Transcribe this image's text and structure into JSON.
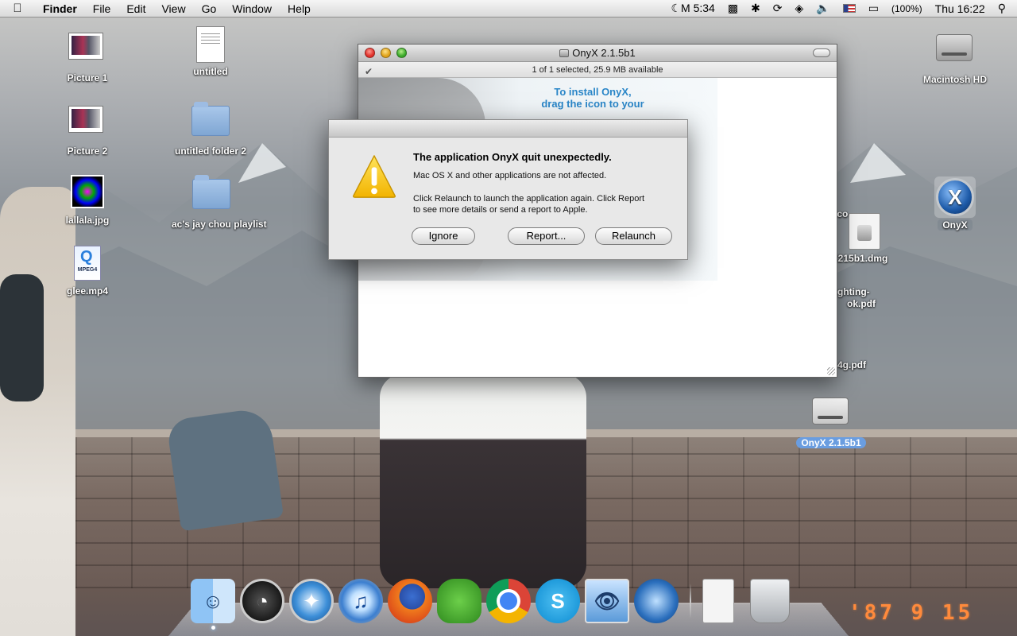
{
  "menubar": {
    "app_name": "Finder",
    "menus": [
      "File",
      "Edit",
      "View",
      "Go",
      "Window",
      "Help"
    ],
    "status": {
      "moon_time": "☾M 5:34",
      "battery_percent": "(100%)",
      "clock": "Thu 16:22"
    }
  },
  "desktop_icons": {
    "picture1": "Picture 1",
    "untitled": "untitled",
    "macintosh_hd": "Macintosh HD",
    "picture2": "Picture 2",
    "untitled_folder2": "untitled folder 2",
    "lallala": "lallala.jpg",
    "playlist": "ac's jay chou playlist",
    "onyx_app": "OnyX",
    "glee": "glee.mp4",
    "dmg_partial": "yX215b1.dmg",
    "pdf1_line1": "ghting-",
    "pdf1_line2": "ok.pdf",
    "pdf2": "4g.pdf",
    "ico_partial": "ico",
    "onyx_volume": "OnyX 2.1.5b1"
  },
  "finder_window": {
    "title": "OnyX 2.1.5b1",
    "status": "1 of 1 selected, 25.9 MB available",
    "install_line1": "To install OnyX,",
    "install_line2": "drag the icon to your"
  },
  "alert": {
    "heading": "The application OnyX quit unexpectedly.",
    "subtext": "Mac OS X and other applications are not affected.",
    "message": "Click Relaunch to launch the application again. Click Report to see more details or send a report to Apple.",
    "buttons": {
      "ignore": "Ignore",
      "report": "Report...",
      "relaunch": "Relaunch"
    }
  },
  "dock": {
    "apps": [
      "finder-icon",
      "dashboard-icon",
      "safari-icon",
      "itunes-icon",
      "firefox-icon",
      "adium-icon",
      "chrome-icon",
      "skype-icon",
      "preview-icon",
      "remote-desktop-icon"
    ]
  },
  "photo_datestamp": "'87  9  15",
  "colors": {
    "selection_label": "#6a9de0",
    "install_text": "#2a86c8",
    "alert_bg": "#e8e8e8"
  }
}
